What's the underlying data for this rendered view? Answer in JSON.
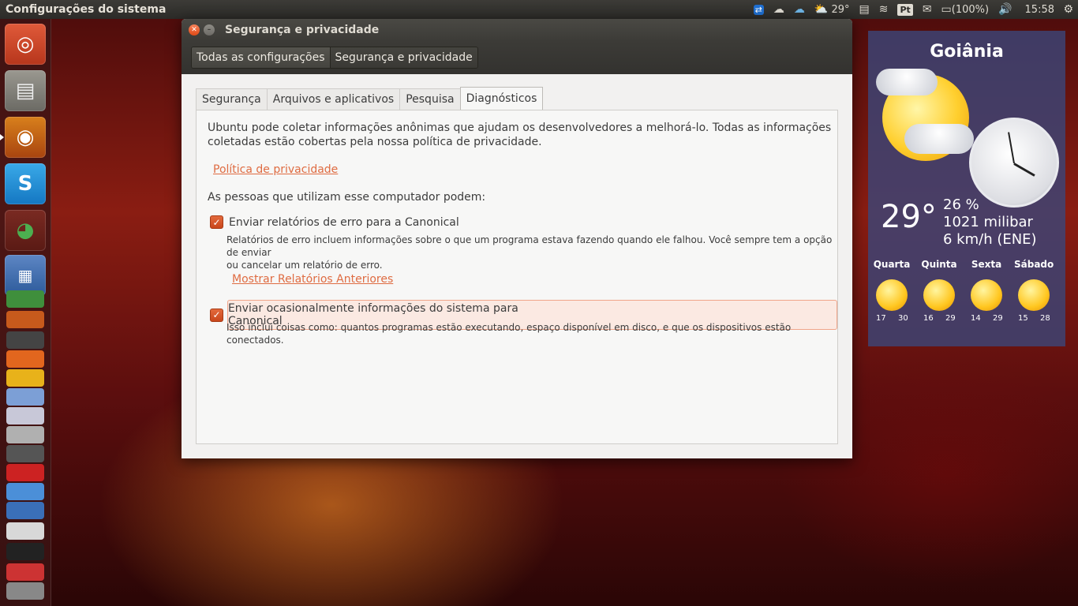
{
  "top_panel": {
    "title": "Configurações do sistema",
    "weather_temp": "29°",
    "language": "Pt",
    "battery": "(100%)",
    "time": "15:58"
  },
  "launcher": {
    "items": [
      "ubuntu-logo",
      "file-cabinet",
      "firefox",
      "skype",
      "chrome",
      "writer",
      "calc",
      "impress",
      "software-center",
      "misc-app",
      "misc-app",
      "misc-app",
      "misc-app",
      "misc-app",
      "misc-app",
      "misc-app",
      "misc-app",
      "misc-app"
    ]
  },
  "window": {
    "title": "Segurança e privacidade",
    "breadcrumbs": [
      "Todas as configurações",
      "Segurança e privacidade"
    ],
    "tabs": [
      "Segurança",
      "Arquivos e aplicativos",
      "Pesquisa",
      "Diagnósticos"
    ],
    "active_tab": "Diagnósticos",
    "intro_line1": "Ubuntu pode coletar informações anônimas que ajudam os desenvolvedores a melhorá-lo. Todas as informações",
    "intro_line2": "coletadas estão cobertas pela nossa política de privacidade.",
    "privacy_link": "Política de privacidade",
    "people_label": "As pessoas que utilizam esse computador podem:",
    "option1": {
      "label": "Enviar relatórios de erro para a Canonical",
      "checked": true,
      "desc_line1": "Relatórios de erro incluem informações sobre o que um programa estava fazendo quando ele falhou. Você sempre tem a opção de enviar",
      "desc_line2": "ou cancelar um relatório de erro."
    },
    "show_reports_link": "Mostrar Relatórios Anteriores",
    "option2": {
      "label": "Enviar ocasionalmente informações do sistema para Canonical",
      "checked": true,
      "desc": "Isso inclui coisas como: quantos programas estão executando, espaço disponível em disco, e que os dispositivos estão conectados."
    },
    "accent_color": "#df6c42"
  },
  "weather_widget": {
    "city": "Goiânia",
    "temperature": "29°",
    "humidity": "26 %",
    "pressure": "1021 milibar",
    "wind": "6 km/h (ENE)",
    "forecast": [
      {
        "day": "Quarta",
        "min": "17",
        "max": "30"
      },
      {
        "day": "Quinta",
        "min": "16",
        "max": "29"
      },
      {
        "day": "Sexta",
        "min": "14",
        "max": "29"
      },
      {
        "day": "Sábado",
        "min": "15",
        "max": "28"
      }
    ]
  }
}
